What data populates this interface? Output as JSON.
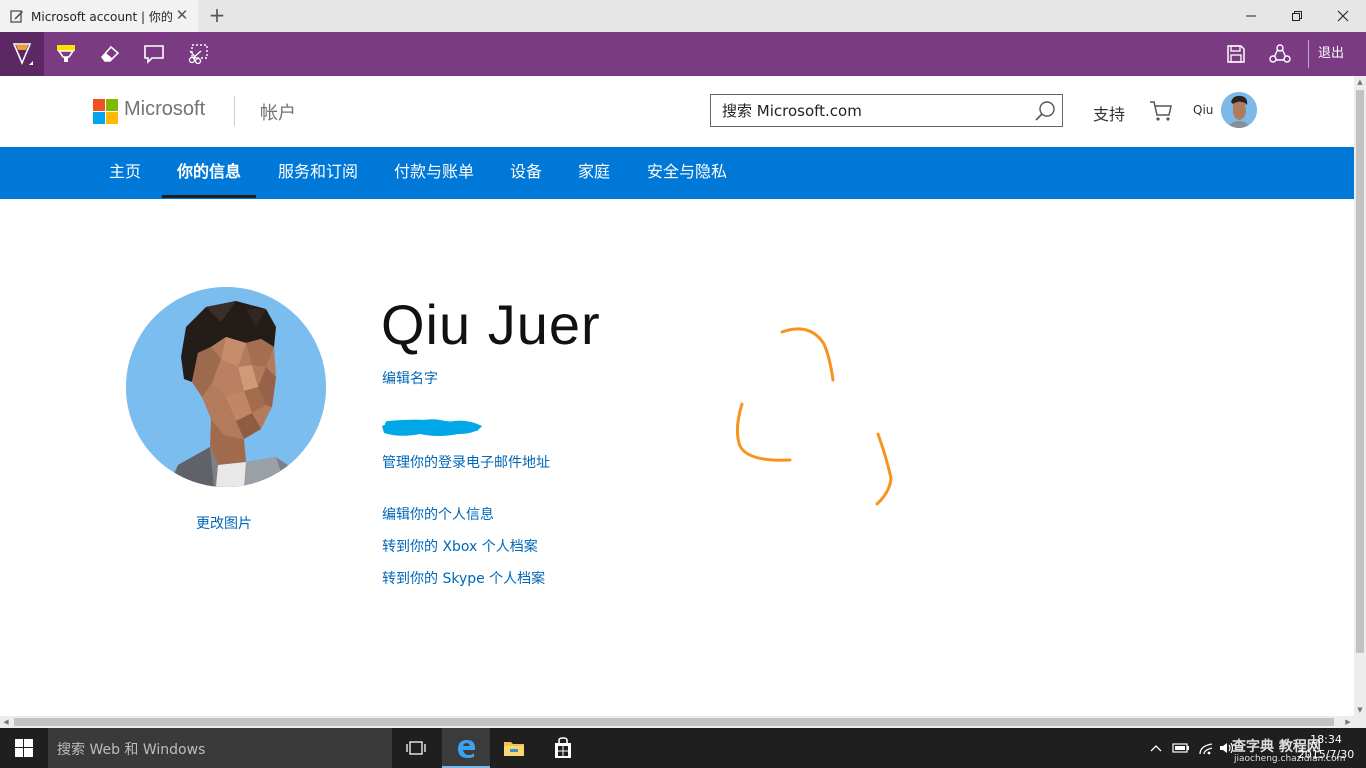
{
  "browser": {
    "tab_title": "Microsoft account | 你的信息",
    "new_tab_symbol": "+",
    "close_symbol": "✕"
  },
  "inking_toolbar": {
    "exit_label": "退出",
    "tools": [
      "ballpoint-pen",
      "highlighter",
      "eraser",
      "typed-note",
      "clip"
    ],
    "accent": "#7a3b83"
  },
  "header": {
    "brand": "Microsoft",
    "section": "帐户",
    "search_placeholder": "搜索 Microsoft.com",
    "support": "支持",
    "user_short": "Qiu"
  },
  "nav": {
    "items": [
      {
        "label": "主页"
      },
      {
        "label": "你的信息",
        "active": true
      },
      {
        "label": "服务和订阅"
      },
      {
        "label": "付款与账单"
      },
      {
        "label": "设备"
      },
      {
        "label": "家庭"
      },
      {
        "label": "安全与隐私"
      }
    ],
    "color": "#0078d7"
  },
  "profile": {
    "name": "Qiu Juer",
    "edit_name": "编辑名字",
    "manage_email": "管理你的登录电子邮件地址",
    "change_picture": "更改图片",
    "edit_personal_info": "编辑你的个人信息",
    "xbox_profile": "转到你的 Xbox 个人档案",
    "skype_profile": "转到你的 Skype 个人档案"
  },
  "taskbar": {
    "search_placeholder": "搜索 Web 和 Windows",
    "clock_time": "18:34",
    "clock_date": "2015/7/30",
    "apps": [
      "task-view",
      "edge",
      "file-explorer",
      "store"
    ]
  },
  "watermark": {
    "line1": "查字典 教程网",
    "line2": "jiaocheng.chazidian.com"
  }
}
